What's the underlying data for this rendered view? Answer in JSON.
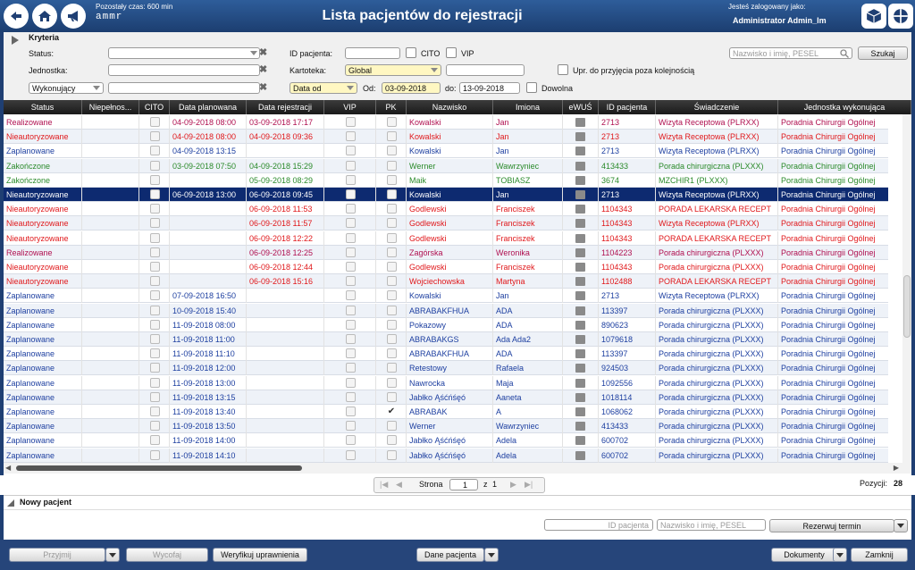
{
  "header": {
    "remaining_time": "Pozostały czas: 600 min",
    "logo_text": "ammr",
    "title": "Lista pacjentów do rejestracji",
    "logged_as_label": "Jesteś zalogowany jako:",
    "user": "Administrator Admin_lm"
  },
  "criteria": {
    "title": "Kryteria",
    "status_label": "Status:",
    "unit_label": "Jednostka:",
    "performer_select": "Wykonujący",
    "patient_id_label": "ID pacjenta:",
    "cito_label": "CITO",
    "vip_label": "VIP",
    "kartoteka_label": "Kartoteka:",
    "kartoteka_value": "Global",
    "urgent_label": "Upr. do przyjęcia poza kolejnością",
    "date_type": "Data od",
    "from_label": "Od:",
    "from_value": "03-09-2018",
    "to_label": "do:",
    "to_value": "13-09-2018",
    "any_label": "Dowolna",
    "search_placeholder": "Nazwisko i imię, PESEL",
    "search_button": "Szukaj"
  },
  "columns": [
    "Status",
    "Niepełnos...",
    "CITO",
    "Data planowana",
    "Data rejestracji",
    "VIP",
    "PK",
    "Nazwisko",
    "Imiona",
    "eWUŚ",
    "ID pacjenta",
    "Świadczenie",
    "Jednostka wykonująca"
  ],
  "rows": [
    {
      "status": "Realizowane",
      "planned": "04-09-2018  08:00",
      "registered": "03-09-2018  17:17",
      "surname": "Kowalski",
      "name": "Jan",
      "pid": "2713",
      "service": "Wizyta Receptowa (PLRXX)",
      "unit": "Poradnia Chirurgii Ogólnej",
      "color": "mag",
      "pk": ""
    },
    {
      "status": "Nieautoryzowane",
      "planned": "04-09-2018  08:00",
      "registered": "04-09-2018  09:36",
      "surname": "Kowalski",
      "name": "Jan",
      "pid": "2713",
      "service": "Wizyta Receptowa (PLRXX)",
      "unit": "Poradnia Chirurgii Ogólnej",
      "color": "red",
      "pk": ""
    },
    {
      "status": "Zaplanowane",
      "planned": "04-09-2018  13:15",
      "registered": "",
      "surname": "Kowalski",
      "name": "Jan",
      "pid": "2713",
      "service": "Wizyta Receptowa (PLRXX)",
      "unit": "Poradnia Chirurgii Ogólnej",
      "color": "blue",
      "pk": ""
    },
    {
      "status": "Zakończone",
      "planned": "03-09-2018  07:50",
      "registered": "04-09-2018  15:29",
      "surname": "Werner",
      "name": "Wawrzyniec",
      "pid": "413433",
      "service": "Porada chirurgiczna (PLXXX)",
      "unit": "Poradnia Chirurgii Ogólnej",
      "color": "green",
      "pk": ""
    },
    {
      "status": "Zakończone",
      "planned": "",
      "registered": "05-09-2018  08:29",
      "surname": "Maik",
      "name": "TOBIASZ",
      "pid": "3674",
      "service": "MZCHIR1 (PLXXX)",
      "unit": "Poradnia Chirurgii Ogólnej",
      "color": "green",
      "pk": ""
    },
    {
      "status": "Nieautoryzowane",
      "planned": "06-09-2018  13:00",
      "registered": "06-09-2018  09:45",
      "surname": "Kowalski",
      "name": "Jan",
      "pid": "2713",
      "service": "Wizyta Receptowa (PLRXX)",
      "unit": "Poradnia Chirurgii Ogólnej",
      "color": "red",
      "selected": true,
      "pk": ""
    },
    {
      "status": "Nieautoryzowane",
      "planned": "",
      "registered": "06-09-2018  11:53",
      "surname": "Godlewski",
      "name": "Franciszek",
      "pid": "1104343",
      "service": "PORADA LEKARSKA RECEPT",
      "unit": "Poradnia Chirurgii Ogólnej",
      "color": "red",
      "pk": ""
    },
    {
      "status": "Nieautoryzowane",
      "planned": "",
      "registered": "06-09-2018  11:57",
      "surname": "Godlewski",
      "name": "Franciszek",
      "pid": "1104343",
      "service": "Wizyta Receptowa (PLRXX)",
      "unit": "Poradnia Chirurgii Ogólnej",
      "color": "red",
      "pk": ""
    },
    {
      "status": "Nieautoryzowane",
      "planned": "",
      "registered": "06-09-2018  12:22",
      "surname": "Godlewski",
      "name": "Franciszek",
      "pid": "1104343",
      "service": "PORADA LEKARSKA RECEPT",
      "unit": "Poradnia Chirurgii Ogólnej",
      "color": "red",
      "pk": ""
    },
    {
      "status": "Realizowane",
      "planned": "",
      "registered": "06-09-2018  12:25",
      "surname": "Zagórska",
      "name": "Weronika",
      "pid": "1104223",
      "service": "Porada chirurgiczna (PLXXX)",
      "unit": "Poradnia Chirurgii Ogólnej",
      "color": "mag",
      "pk": ""
    },
    {
      "status": "Nieautoryzowane",
      "planned": "",
      "registered": "06-09-2018  12:44",
      "surname": "Godlewski",
      "name": "Franciszek",
      "pid": "1104343",
      "service": "Porada chirurgiczna (PLXXX)",
      "unit": "Poradnia Chirurgii Ogólnej",
      "color": "red",
      "pk": ""
    },
    {
      "status": "Nieautoryzowane",
      "planned": "",
      "registered": "06-09-2018  15:16",
      "surname": "Wojciechowska",
      "name": "Martyna",
      "pid": "1102488",
      "service": "PORADA LEKARSKA RECEPT",
      "unit": "Poradnia Chirurgii Ogólnej",
      "color": "red",
      "pk": ""
    },
    {
      "status": "Zaplanowane",
      "planned": "07-09-2018  16:50",
      "registered": "",
      "surname": "Kowalski",
      "name": "Jan",
      "pid": "2713",
      "service": "Wizyta Receptowa (PLRXX)",
      "unit": "Poradnia Chirurgii Ogólnej",
      "color": "blue",
      "pk": ""
    },
    {
      "status": "Zaplanowane",
      "planned": "10-09-2018  15:40",
      "registered": "",
      "surname": "ABRABAKFHUA",
      "name": "ADA",
      "pid": "113397",
      "service": "Porada chirurgiczna (PLXXX)",
      "unit": "Poradnia Chirurgii Ogólnej",
      "color": "blue",
      "pk": ""
    },
    {
      "status": "Zaplanowane",
      "planned": "11-09-2018  08:00",
      "registered": "",
      "surname": "Pokazowy",
      "name": "ADA",
      "pid": "890623",
      "service": "Porada chirurgiczna (PLXXX)",
      "unit": "Poradnia Chirurgii Ogólnej",
      "color": "blue",
      "pk": ""
    },
    {
      "status": "Zaplanowane",
      "planned": "11-09-2018  11:00",
      "registered": "",
      "surname": "ABRABAKGS",
      "name": "Ada Ada2",
      "pid": "1079618",
      "service": "Porada chirurgiczna (PLXXX)",
      "unit": "Poradnia Chirurgii Ogólnej",
      "color": "blue",
      "pk": ""
    },
    {
      "status": "Zaplanowane",
      "planned": "11-09-2018  11:10",
      "registered": "",
      "surname": "ABRABAKFHUA",
      "name": "ADA",
      "pid": "113397",
      "service": "Porada chirurgiczna (PLXXX)",
      "unit": "Poradnia Chirurgii Ogólnej",
      "color": "blue",
      "pk": ""
    },
    {
      "status": "Zaplanowane",
      "planned": "11-09-2018  12:00",
      "registered": "",
      "surname": "Retestowy",
      "name": "Rafaela",
      "pid": "924503",
      "service": "Porada chirurgiczna (PLXXX)",
      "unit": "Poradnia Chirurgii Ogólnej",
      "color": "blue",
      "pk": ""
    },
    {
      "status": "Zaplanowane",
      "planned": "11-09-2018  13:00",
      "registered": "",
      "surname": "Nawrocka",
      "name": "Maja",
      "pid": "1092556",
      "service": "Porada chirurgiczna (PLXXX)",
      "unit": "Poradnia Chirurgii Ogólnej",
      "color": "blue",
      "pk": ""
    },
    {
      "status": "Zaplanowane",
      "planned": "11-09-2018  13:15",
      "registered": "",
      "surname": "Jabłko Ąśćńśęó",
      "name": "Aaneta",
      "pid": "1018114",
      "service": "Porada chirurgiczna (PLXXX)",
      "unit": "Poradnia Chirurgii Ogólnej",
      "color": "blue",
      "pk": ""
    },
    {
      "status": "Zaplanowane",
      "planned": "11-09-2018  13:40",
      "registered": "",
      "surname": "ABRABAK",
      "name": "A",
      "pid": "1068062",
      "service": "Porada chirurgiczna (PLXXX)",
      "unit": "Poradnia Chirurgii Ogólnej",
      "color": "blue",
      "pk": "✔"
    },
    {
      "status": "Zaplanowane",
      "planned": "11-09-2018  13:50",
      "registered": "",
      "surname": "Werner",
      "name": "Wawrzyniec",
      "pid": "413433",
      "service": "Porada chirurgiczna (PLXXX)",
      "unit": "Poradnia Chirurgii Ogólnej",
      "color": "blue",
      "pk": ""
    },
    {
      "status": "Zaplanowane",
      "planned": "11-09-2018  14:00",
      "registered": "",
      "surname": "Jabłko Ąśćńśęó",
      "name": "Adela",
      "pid": "600702",
      "service": "Porada chirurgiczna (PLXXX)",
      "unit": "Poradnia Chirurgii Ogólnej",
      "color": "blue",
      "pk": ""
    },
    {
      "status": "Zaplanowane",
      "planned": "11-09-2018  14:10",
      "registered": "",
      "surname": "Jabłko Ąśćńśęó",
      "name": "Adela",
      "pid": "600702",
      "service": "Porada chirurgiczna (PLXXX)",
      "unit": "Poradnia Chirurgii Ogólnej",
      "color": "blue",
      "pk": ""
    }
  ],
  "pager": {
    "page_label": "Strona",
    "page": "1",
    "of_label": "z",
    "total_pages": "1",
    "positions_label": "Pozycji:",
    "positions": "28"
  },
  "new_patient": {
    "title": "Nowy pacjent",
    "id_placeholder": "ID pacjenta",
    "name_placeholder": "Nazwisko i imię, PESEL",
    "reserve_button": "Rezerwuj termin"
  },
  "footer": {
    "accept": "Przyjmij",
    "withdraw": "Wycofaj",
    "verify": "Weryfikuj uprawnienia",
    "patient_data": "Dane pacjenta",
    "documents": "Dokumenty",
    "close": "Zamknij"
  }
}
